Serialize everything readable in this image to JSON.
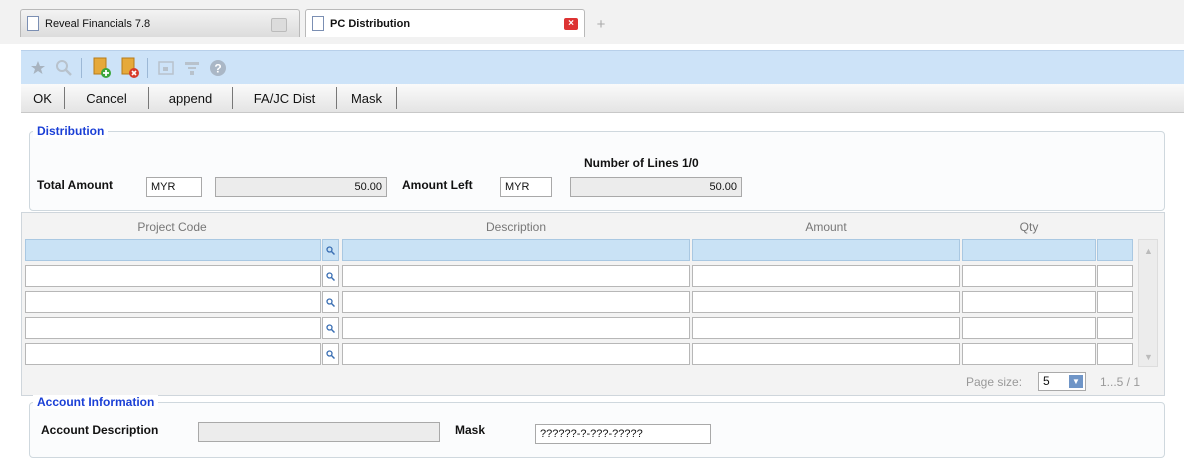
{
  "tabs": [
    {
      "label": "Reveal Financials 7.8"
    },
    {
      "label": "PC Distribution"
    }
  ],
  "toolbar": {
    "icons": [
      "star-icon",
      "search-icon",
      "add-document-icon",
      "delete-document-icon",
      "window-icon",
      "filter-icon",
      "help-icon"
    ]
  },
  "buttons": {
    "ok": "OK",
    "cancel": "Cancel",
    "append": "append",
    "fajc": "FA/JC Dist",
    "mask": "Mask"
  },
  "distribution": {
    "legend": "Distribution",
    "lines_label": "Number of Lines 1/0",
    "total_label": "Total Amount",
    "total_currency": "MYR",
    "total_value": "50.00",
    "left_label": "Amount Left",
    "left_currency": "MYR",
    "left_value": "50.00"
  },
  "grid": {
    "columns": [
      "Project Code",
      "Description",
      "Amount",
      "Qty"
    ],
    "rows": 5,
    "page_size_label": "Page size:",
    "page_size": "5",
    "page_info": "1...5 / 1"
  },
  "account": {
    "legend": "Account Information",
    "desc_label": "Account Description",
    "desc_value": "",
    "mask_label": "Mask",
    "mask_value": "??????-?-???-?????"
  },
  "colors": {
    "legend": "#1a3fd6",
    "toolbar": "#cde3f8",
    "selected_row": "#c9e2f5"
  }
}
